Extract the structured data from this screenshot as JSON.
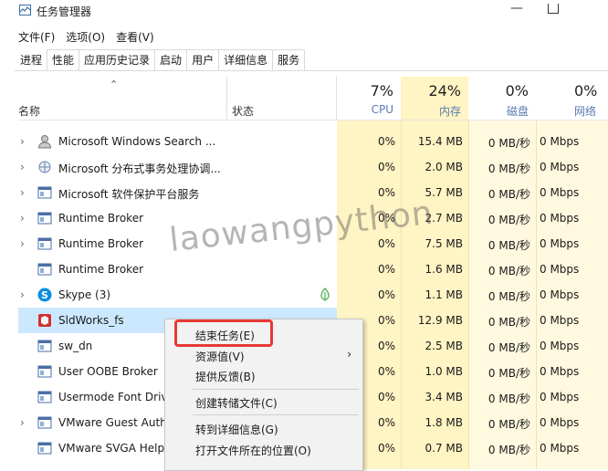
{
  "window": {
    "title": "任务管理器"
  },
  "menu": [
    "文件(F)",
    "选项(O)",
    "查看(V)"
  ],
  "tabs": [
    "进程",
    "性能",
    "应用历史记录",
    "启动",
    "用户",
    "详细信息",
    "服务"
  ],
  "header": {
    "name": "名称",
    "status": "状态",
    "cpu": {
      "pct": "7%",
      "label": "CPU"
    },
    "mem": {
      "pct": "24%",
      "label": "内存"
    },
    "disk": {
      "pct": "0%",
      "label": "磁盘"
    },
    "net": {
      "pct": "0%",
      "label": "网络"
    }
  },
  "rows": [
    {
      "name": "Microsoft Windows Search ...",
      "expand": "›",
      "icon": "user-icon",
      "cpu": "0%",
      "mem": "15.4 MB",
      "disk": "0 MB/秒",
      "net": "0 Mbps"
    },
    {
      "name": "Microsoft 分布式事务处理协调...",
      "expand": "›",
      "icon": "network-icon",
      "cpu": "0%",
      "mem": "2.0 MB",
      "disk": "0 MB/秒",
      "net": "0 Mbps"
    },
    {
      "name": "Microsoft 软件保护平台服务",
      "expand": "›",
      "icon": "window-icon",
      "cpu": "0%",
      "mem": "5.7 MB",
      "disk": "0 MB/秒",
      "net": "0 Mbps"
    },
    {
      "name": "Runtime Broker",
      "expand": "›",
      "icon": "window-icon",
      "cpu": "0%",
      "mem": "2.7 MB",
      "disk": "0 MB/秒",
      "net": "0 Mbps"
    },
    {
      "name": "Runtime Broker",
      "expand": "›",
      "icon": "window-icon",
      "cpu": "0%",
      "mem": "7.5 MB",
      "disk": "0 MB/秒",
      "net": "0 Mbps"
    },
    {
      "name": "Runtime Broker",
      "expand": "",
      "icon": "window-icon",
      "cpu": "0%",
      "mem": "1.6 MB",
      "disk": "0 MB/秒",
      "net": "0 Mbps"
    },
    {
      "name": "Skype (3)",
      "expand": "›",
      "icon": "skype-icon",
      "cpu": "0%",
      "mem": "1.1 MB",
      "disk": "0 MB/秒",
      "net": "0 Mbps",
      "status_icon": "leaf-icon"
    },
    {
      "name": "SldWorks_fs",
      "expand": "",
      "icon": "solidworks-icon",
      "cpu": "0%",
      "mem": "12.9 MB",
      "disk": "0 MB/秒",
      "net": "0 Mbps",
      "selected": true
    },
    {
      "name": "sw_dn",
      "expand": "",
      "icon": "window-icon",
      "cpu": "0%",
      "mem": "2.5 MB",
      "disk": "0 MB/秒",
      "net": "0 Mbps"
    },
    {
      "name": "User OOBE Broker",
      "expand": "",
      "icon": "window-icon",
      "cpu": "0%",
      "mem": "1.0 MB",
      "disk": "0 MB/秒",
      "net": "0 Mbps"
    },
    {
      "name": "Usermode Font Driv",
      "expand": "",
      "icon": "window-icon",
      "cpu": "0%",
      "mem": "3.4 MB",
      "disk": "0 MB/秒",
      "net": "0 Mbps"
    },
    {
      "name": "VMware Guest Auth",
      "expand": "›",
      "icon": "window-icon",
      "cpu": "0%",
      "mem": "1.8 MB",
      "disk": "0 MB/秒",
      "net": "0 Mbps"
    },
    {
      "name": "VMware SVGA Help",
      "expand": "",
      "icon": "window-icon",
      "cpu": "0%",
      "mem": "0.7 MB",
      "disk": "0 MB/秒",
      "net": "0 Mbps"
    }
  ],
  "context_menu": {
    "end_task": "结束任务(E)",
    "resource_values": "资源值(V)",
    "feedback": "提供反馈(B)",
    "create_dump": "创建转储文件(C)",
    "go_to_details": "转到详细信息(G)",
    "open_file_location": "打开文件所在的位置(O)"
  },
  "watermark": "laowangpython",
  "colors": {
    "highlight_col": "#fff4c4",
    "selected_row": "#cce8ff",
    "annotation_box": "#e53935"
  }
}
